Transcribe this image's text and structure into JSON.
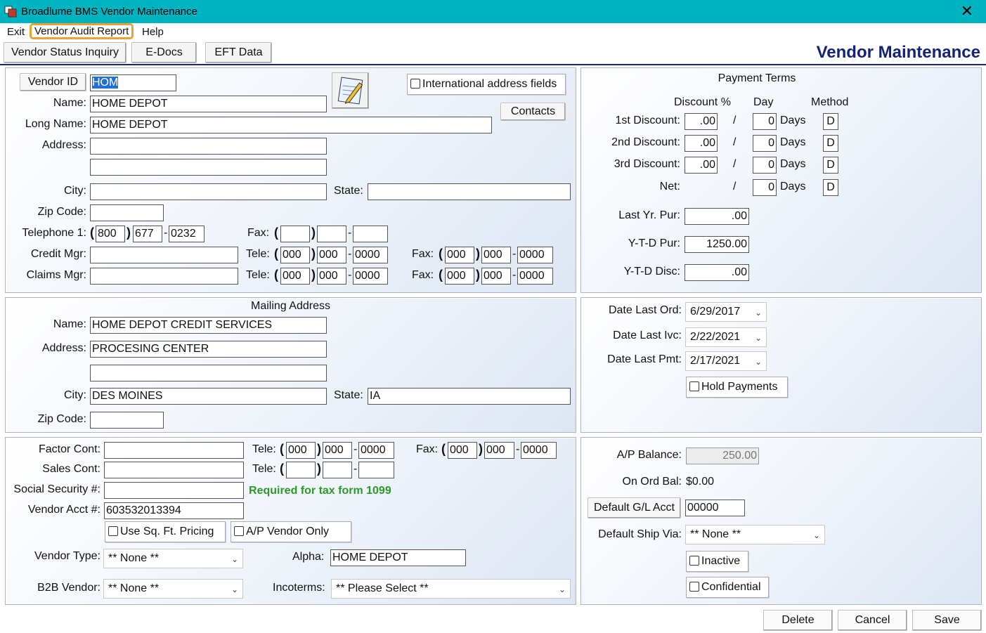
{
  "window": {
    "title": "Broadlume BMS Vendor Maintenance",
    "close_icon": "close-icon"
  },
  "menu": {
    "exit": "Exit",
    "audit": "Vendor Audit Report",
    "help": "Help"
  },
  "tabs": {
    "status": "Vendor Status Inquiry",
    "edocs": "E-Docs",
    "eft": "EFT Data"
  },
  "page_title": "Vendor Maintenance",
  "vendor": {
    "id_button": "Vendor ID",
    "id_value": "HOM",
    "intl_label": "International address fields",
    "contacts": "Contacts",
    "name_label": "Name:",
    "name": "HOME DEPOT",
    "long_name_label": "Long Name:",
    "long_name": "HOME DEPOT",
    "address_label": "Address:",
    "address1": "",
    "address2": "",
    "city_label": "City:",
    "city": "",
    "state_label": "State:",
    "state": "",
    "zip_label": "Zip Code:",
    "zip": "",
    "tel1_label": "Telephone 1:",
    "tel1": [
      "800",
      "677",
      "0232"
    ],
    "fax_label": "Fax:",
    "fax": [
      "",
      "",
      ""
    ],
    "credit_label": "Credit Mgr:",
    "credit": "",
    "tele_label": "Tele:",
    "credit_tel": [
      "000",
      "000",
      "0000"
    ],
    "credit_fax": [
      "000",
      "000",
      "0000"
    ],
    "claims_label": "Claims Mgr:",
    "claims": "",
    "claims_tel": [
      "000",
      "000",
      "0000"
    ],
    "claims_fax": [
      "000",
      "000",
      "0000"
    ]
  },
  "payment": {
    "title": "Payment Terms",
    "col_discount": "Discount %",
    "col_day": "Day",
    "col_method": "Method",
    "slash": "/",
    "days": "Days",
    "rows": [
      {
        "label": "1st Discount:",
        "pct": ".00",
        "day": "0",
        "method": "D"
      },
      {
        "label": "2nd Discount:",
        "pct": ".00",
        "day": "0",
        "method": "D"
      },
      {
        "label": "3rd Discount:",
        "pct": ".00",
        "day": "0",
        "method": "D"
      },
      {
        "label": "Net:",
        "day": "0",
        "method": "D"
      }
    ],
    "last_yr_label": "Last Yr. Pur:",
    "last_yr": ".00",
    "ytd_pur_label": "Y-T-D Pur:",
    "ytd_pur": "1250.00",
    "ytd_disc_label": "Y-T-D Disc:",
    "ytd_disc": ".00"
  },
  "mailing": {
    "title": "Mailing Address",
    "name_label": "Name:",
    "name": "HOME DEPOT CREDIT SERVICES",
    "address_label": "Address:",
    "address1": "PROCESING CENTER",
    "address2": "",
    "city_label": "City:",
    "city": "DES MOINES",
    "state_label": "State:",
    "state": "IA",
    "zip_label": "Zip Code:",
    "zip": ""
  },
  "dates": {
    "last_ord_label": "Date Last Ord:",
    "last_ord": "6/29/2017",
    "last_ivc_label": "Date Last Ivc:",
    "last_ivc": "2/22/2021",
    "last_pmt_label": "Date Last Pmt:",
    "last_pmt": "2/17/2021",
    "hold": "Hold Payments"
  },
  "other": {
    "factor_label": "Factor Cont:",
    "factor": "",
    "sales_label": "Sales Cont:",
    "sales": "",
    "tele_label": "Tele:",
    "fax_label": "Fax:",
    "factor_tel": [
      "000",
      "000",
      "0000"
    ],
    "factor_fax": [
      "000",
      "000",
      "0000"
    ],
    "sales_tel": [
      "",
      "",
      ""
    ],
    "ssn_label": "Social Security #:",
    "ssn": "",
    "required_note": "Required for tax form 1099",
    "acct_label": "Vendor Acct #:",
    "acct": "603532013394",
    "sqft": "Use Sq. Ft. Pricing",
    "ap_only": "A/P Vendor Only",
    "type_label": "Vendor Type:",
    "type": "** None **",
    "alpha_label": "Alpha:",
    "alpha": "HOME DEPOT",
    "b2b_label": "B2B Vendor:",
    "b2b": "** None **",
    "inco_label": "Incoterms:",
    "inco": "** Please Select **"
  },
  "balance": {
    "ap_label": "A/P Balance:",
    "ap": "250.00",
    "onord_label": "On Ord Bal:",
    "onord": "$0.00",
    "gl_button": "Default G/L Acct",
    "gl": "00000",
    "ship_label": "Default Ship Via:",
    "ship": "** None **",
    "inactive": "Inactive",
    "confidential": "Confidential"
  },
  "actions": {
    "delete": "Delete",
    "cancel": "Cancel",
    "save": "Save"
  },
  "colors": {
    "titlebar": "#00b3c0",
    "accent": "#14237a",
    "highlight": "#f0a030",
    "note": "#2a9a2a"
  }
}
